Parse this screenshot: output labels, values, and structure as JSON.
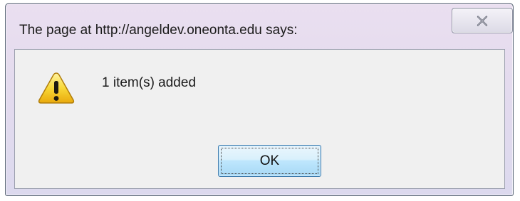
{
  "dialog": {
    "title": "The page at http://angeldev.oneonta.edu says:",
    "message": "1 item(s) added",
    "ok_label": "OK",
    "close_icon": "close-icon",
    "warning_icon": "warning-icon"
  },
  "colors": {
    "title_bar": "#e4dbee",
    "content_bg": "#f0f0f0",
    "ok_border": "#3d7bad",
    "warning_yellow": "#f6d02a"
  }
}
